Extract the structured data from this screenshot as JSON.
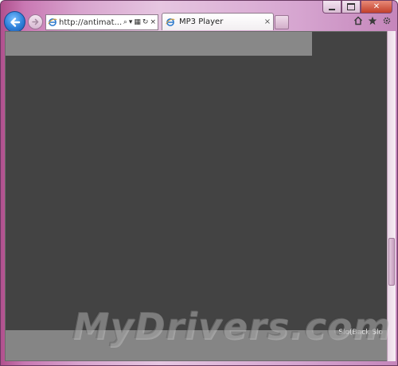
{
  "browser": {
    "address_url": "http://antimat...",
    "tab_title": "MP3 Player",
    "tab_close": "×",
    "address_tools": {
      "search": "⌕",
      "dropdown": "▾",
      "compat": "▦",
      "refresh": "↻",
      "stop": "×"
    },
    "icons": [
      "back-arrow-icon",
      "forward-arrow-icon",
      "ie-logo-icon",
      "home-icon",
      "star-icon",
      "gear-icon"
    ],
    "accent_color": "#c978b3"
  },
  "window_controls": {
    "close_label": "✕"
  },
  "player": {
    "background_color": "#434343",
    "panel_color": "#888888",
    "footer_text": "Slo(Back Slo"
  },
  "watermark": {
    "text": "MyDrivers.com"
  }
}
